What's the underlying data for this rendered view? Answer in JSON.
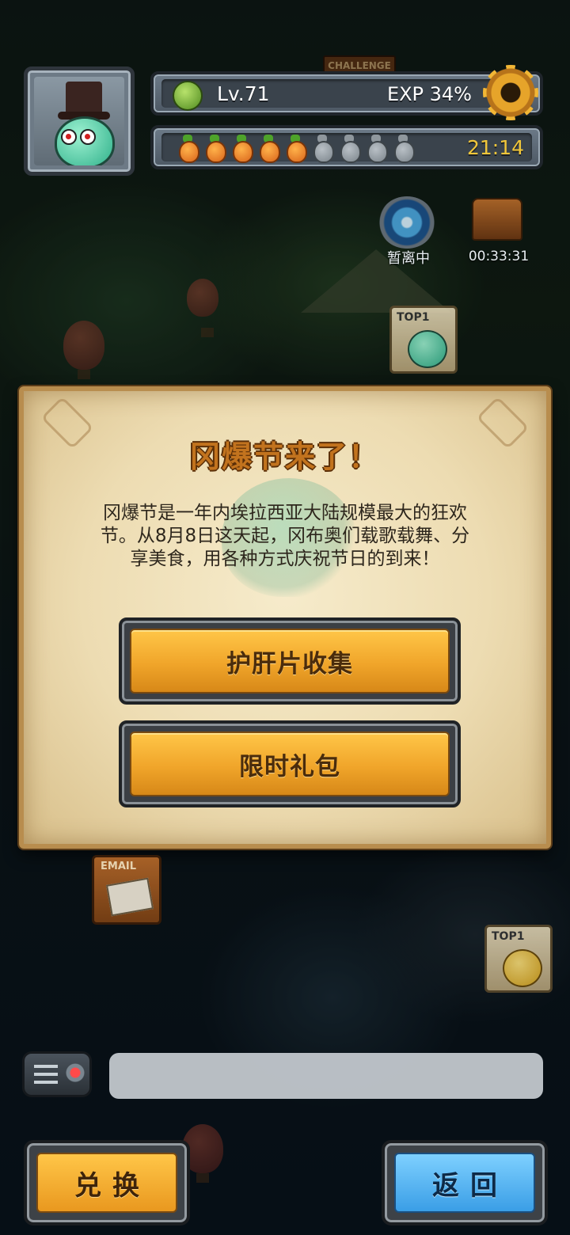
{
  "hud": {
    "level_label": "Lv.71",
    "exp_label": "EXP 34%",
    "exp_percent": 34,
    "energy_timer": "21:14",
    "energy_full": 5,
    "energy_total": 9,
    "settings_icon": "gear-icon",
    "level_icon": "leaf-icon",
    "energy_icon": "carrot-icon"
  },
  "map": {
    "challenge_label": "CHALLENGE",
    "portal_label": "暂离中",
    "chest_timer": "00:33:31",
    "top_card_label": "TOP1",
    "top_card_label_2": "TOP1",
    "mail_label": "EMAIL"
  },
  "dialog": {
    "title": "冈爆节来了！",
    "body_line1": "冈爆节是一年内埃拉西亚大陆规模最大的狂欢",
    "body_line2": "节。从8月8日这天起，冈布奥们载歌载舞、分",
    "body_line3": "享美食，用各种方式庆祝节日的到来！",
    "button_collect": "护肝片收集",
    "button_gift": "限时礼包"
  },
  "bottom": {
    "chat_placeholder": "",
    "exchange_label": "兑换",
    "back_label": "返回"
  },
  "colors": {
    "accent_orange": "#f0a52a",
    "accent_blue": "#3a9ee6",
    "title_color": "#c2731e",
    "timer_color": "#f0c63a"
  }
}
